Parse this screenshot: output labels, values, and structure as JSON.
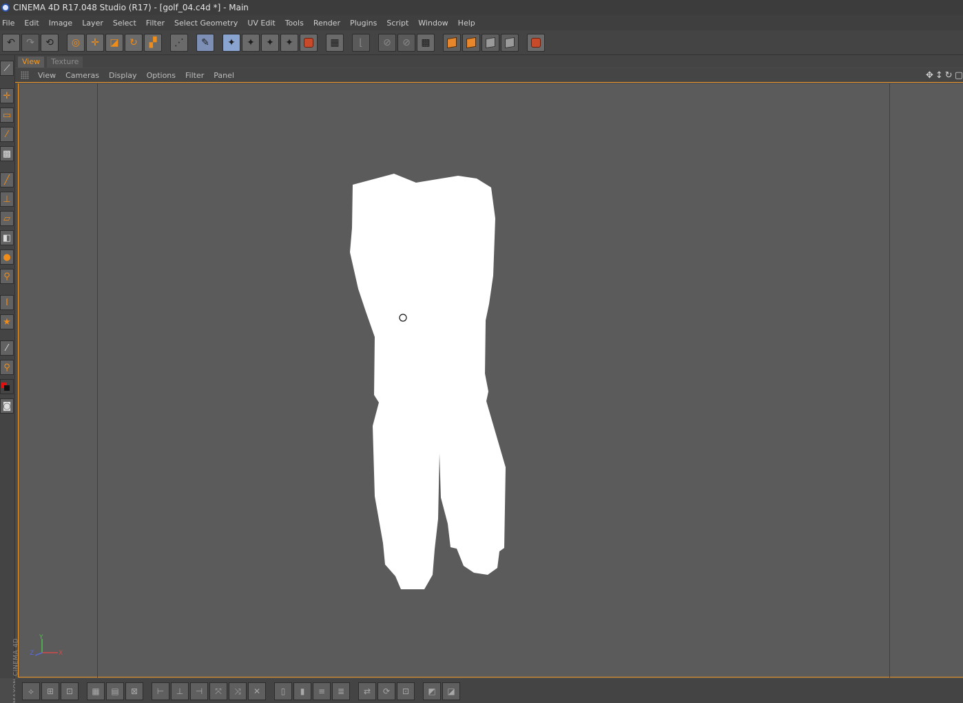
{
  "window": {
    "title": "CINEMA 4D R17.048 Studio (R17) - [golf_04.c4d *] - Main"
  },
  "menu": [
    "File",
    "Edit",
    "Image",
    "Layer",
    "Select",
    "Filter",
    "Select Geometry",
    "UV Edit",
    "Tools",
    "Render",
    "Plugins",
    "Script",
    "Window",
    "Help"
  ],
  "panel_tabs": {
    "view": "View",
    "texture": "Texture"
  },
  "viewport_menu": [
    "View",
    "Cameras",
    "Display",
    "Options",
    "Filter",
    "Panel"
  ],
  "axis_gizmo": {
    "y_label": "Y",
    "x_label": "X",
    "z_label": "Z",
    "colors": {
      "x": "#d44a4a",
      "y": "#4ec24e",
      "z": "#5a6ad8"
    }
  },
  "branding": "MAXON CINEMA 4D",
  "colors": {
    "accent": "#f29b2a",
    "viewport_bg": "#5b5b5b",
    "uv_shape": "#ffffff"
  },
  "icons": {
    "toolbar": [
      "undo-icon",
      "redo-icon",
      "undo-view-icon",
      "live-selection-icon",
      "move-icon",
      "scale-icon",
      "rotate-icon",
      "recent-tools-icon",
      "snap-icon",
      "paint-3d-icon",
      "uv-points-icon",
      "uv-edges-icon",
      "uv-polygons-icon",
      "uv-polygon-select-icon",
      "uv-layer-icon",
      "render-view-icon",
      "workplane-icon",
      "axis-lock-icon",
      "checker-icon",
      "cube-orange-icon",
      "cube-front-icon",
      "cube-side-icon",
      "cube-gray-icon",
      "render-settings-icon"
    ]
  }
}
